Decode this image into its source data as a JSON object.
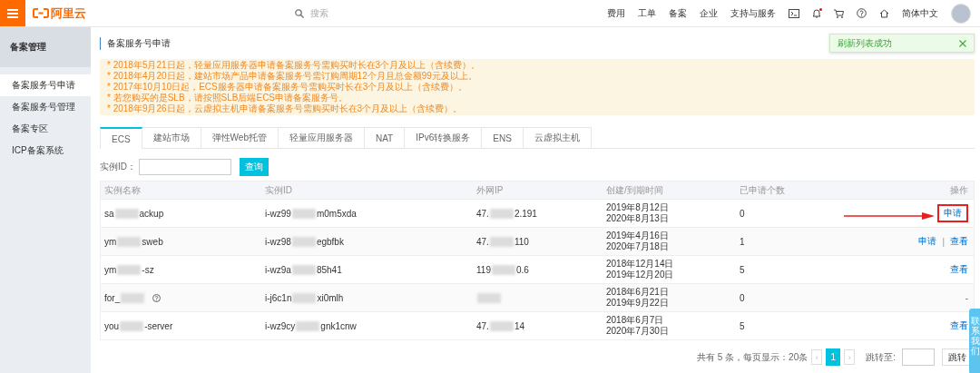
{
  "topbar": {
    "logo_text": "阿里云",
    "search": {
      "placeholder": "搜索"
    },
    "nav": [
      "费用",
      "工单",
      "备案",
      "企业",
      "支持与服务"
    ],
    "language": "简体中文",
    "notification_dot": true
  },
  "sidebar": {
    "title": "备案管理",
    "items": [
      {
        "label": "备案服务号申请",
        "selected": true
      },
      {
        "label": "备案服务号管理",
        "selected": false
      },
      {
        "label": "备案专区",
        "selected": false
      },
      {
        "label": "ICP备案系统",
        "selected": false
      }
    ]
  },
  "page_title": "备案服务号申请",
  "notices": [
    "* 2018年5月21日起，轻量应用服务器申请备案服务号需购买时长在3个月及以上（含续费）。",
    "* 2018年4月20日起，建站市场产品申请备案服务号需订购周期12个月且总金额99元及以上。",
    "* 2017年10月10日起，ECS服务器申请备案服务号需购买时长在3个月及以上（含续费）。",
    "* 若您购买的是SLB，请按照SLB后端ECS申请备案服务号。",
    "* 2018年9月26日起，云虚拟主机申请备案服务号需购买时长在3个月及以上（含续费）。"
  ],
  "tabs": [
    {
      "label": "ECS",
      "selected": true
    },
    {
      "label": "建站市场",
      "selected": false
    },
    {
      "label": "弹性Web托管",
      "selected": false
    },
    {
      "label": "轻量应用服务器",
      "selected": false
    },
    {
      "label": "NAT",
      "selected": false
    },
    {
      "label": "IPv6转换服务",
      "selected": false
    },
    {
      "label": "ENS",
      "selected": false
    },
    {
      "label": "云虚拟主机",
      "selected": false
    }
  ],
  "filter": {
    "label": "实例ID：",
    "button": "查询"
  },
  "table": {
    "columns": [
      "实例名称",
      "实例ID",
      "外网IP",
      "创建/到期时间",
      "已申请个数",
      "操作"
    ],
    "rows": [
      {
        "name": [
          {
            "kind": "text",
            "text": "sa"
          },
          {
            "kind": "redacted"
          },
          {
            "kind": "text",
            "text": "ackup"
          }
        ],
        "help_icon": false,
        "id": [
          {
            "kind": "text",
            "text": "i-wz99"
          },
          {
            "kind": "redacted"
          },
          {
            "kind": "text",
            "text": "m0m5xda"
          }
        ],
        "ip": [
          {
            "kind": "text",
            "text": "47."
          },
          {
            "kind": "redacted"
          },
          {
            "kind": "text",
            "text": "2.191"
          }
        ],
        "created": "2019年8月12日",
        "expires": "2020年8月13日",
        "count": "0",
        "actions": [
          {
            "kind": "link",
            "label": "申请",
            "highlighted": true
          }
        ]
      },
      {
        "name": [
          {
            "kind": "text",
            "text": "ym"
          },
          {
            "kind": "redacted"
          },
          {
            "kind": "text",
            "text": "sweb"
          }
        ],
        "help_icon": false,
        "id": [
          {
            "kind": "text",
            "text": "i-wz98"
          },
          {
            "kind": "redacted"
          },
          {
            "kind": "text",
            "text": "egbfbk"
          }
        ],
        "ip": [
          {
            "kind": "text",
            "text": "47."
          },
          {
            "kind": "redacted"
          },
          {
            "kind": "text",
            "text": "110"
          }
        ],
        "created": "2019年4月16日",
        "expires": "2020年7月18日",
        "count": "1",
        "actions": [
          {
            "kind": "link",
            "label": "申请",
            "highlighted": false
          },
          {
            "kind": "separator",
            "label": "|"
          },
          {
            "kind": "link",
            "label": "查看",
            "highlighted": false
          }
        ]
      },
      {
        "name": [
          {
            "kind": "text",
            "text": "ym"
          },
          {
            "kind": "redacted"
          },
          {
            "kind": "text",
            "text": "-sz"
          }
        ],
        "help_icon": false,
        "id": [
          {
            "kind": "text",
            "text": "i-wz9a"
          },
          {
            "kind": "redacted"
          },
          {
            "kind": "text",
            "text": "85h41"
          }
        ],
        "ip": [
          {
            "kind": "text",
            "text": "119"
          },
          {
            "kind": "redacted"
          },
          {
            "kind": "text",
            "text": "0.6"
          }
        ],
        "created": "2018年12月14日",
        "expires": "2019年12月20日",
        "count": "5",
        "actions": [
          {
            "kind": "link",
            "label": "查看",
            "highlighted": false
          }
        ]
      },
      {
        "name": [
          {
            "kind": "text",
            "text": "for_"
          },
          {
            "kind": "redacted"
          }
        ],
        "help_icon": true,
        "id": [
          {
            "kind": "text",
            "text": "i-j6c1n"
          },
          {
            "kind": "redacted"
          },
          {
            "kind": "text",
            "text": "xi0mlh"
          }
        ],
        "ip": [
          {
            "kind": "redacted"
          }
        ],
        "created": "2018年6月21日",
        "expires": "2019年9月22日",
        "count": "0",
        "actions": [
          {
            "kind": "text",
            "label": "-"
          }
        ]
      },
      {
        "name": [
          {
            "kind": "text",
            "text": "you"
          },
          {
            "kind": "redacted"
          },
          {
            "kind": "text",
            "text": "-server"
          }
        ],
        "help_icon": false,
        "id": [
          {
            "kind": "text",
            "text": "i-wz9cy"
          },
          {
            "kind": "redacted"
          },
          {
            "kind": "text",
            "text": "gnk1cnw"
          }
        ],
        "ip": [
          {
            "kind": "text",
            "text": "47."
          },
          {
            "kind": "redacted"
          },
          {
            "kind": "text",
            "text": "14"
          }
        ],
        "created": "2018年6月7日",
        "expires": "2020年7月30日",
        "count": "5",
        "actions": [
          {
            "kind": "link",
            "label": "查看",
            "highlighted": false
          }
        ]
      }
    ]
  },
  "pagination": {
    "summary": "共有 5 条，每页显示：20条",
    "prev": "‹",
    "pages": [
      {
        "label": "1",
        "selected": true
      }
    ],
    "next": "›",
    "jump_label": "跳转至:",
    "jump_button": "跳转"
  },
  "toast": {
    "message": "刷新列表成功"
  },
  "side_tab": {
    "label": "联系我们"
  }
}
